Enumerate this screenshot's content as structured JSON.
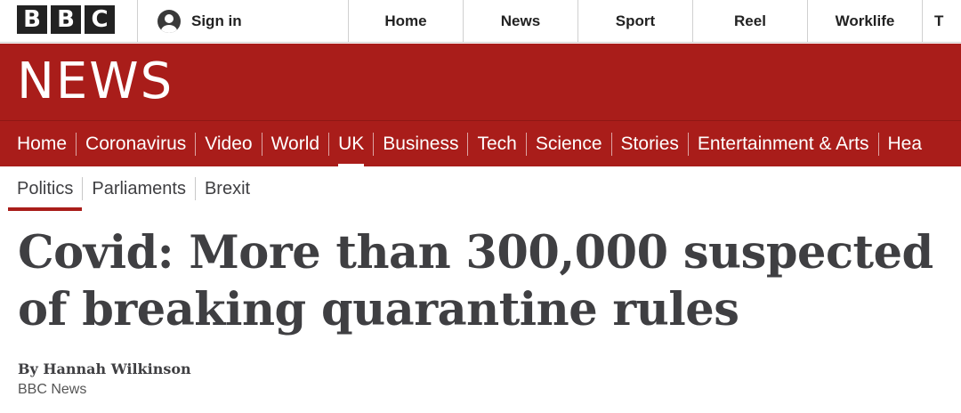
{
  "brand": {
    "letters": [
      "B",
      "B",
      "C"
    ]
  },
  "account": {
    "sign_in_label": "Sign in",
    "icon": "user-icon"
  },
  "top_nav": [
    "Home",
    "News",
    "Sport",
    "Reel",
    "Worklife",
    "T"
  ],
  "masthead": {
    "title": "NEWS",
    "color": "#a91d1a"
  },
  "section_nav": {
    "items": [
      "Home",
      "Coronavirus",
      "Video",
      "World",
      "UK",
      "Business",
      "Tech",
      "Science",
      "Stories",
      "Entertainment & Arts",
      "Hea"
    ],
    "active": "UK"
  },
  "sub_nav": {
    "items": [
      "Politics",
      "Parliaments",
      "Brexit"
    ],
    "active": "Politics"
  },
  "article": {
    "headline": "Covid: More than 300,000 suspected of breaking quarantine rules",
    "byline": "By Hannah Wilkinson",
    "source": "BBC News"
  }
}
